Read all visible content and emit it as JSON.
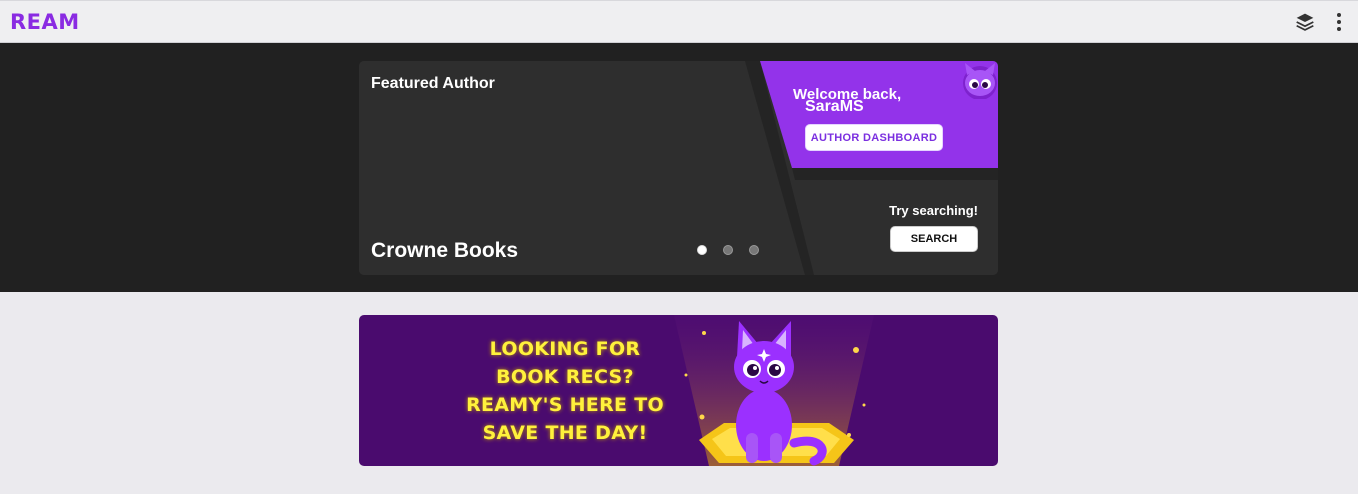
{
  "app": {
    "logo": "REAM"
  },
  "topbar": {
    "icons": [
      "layers-icon",
      "more-vertical-icon"
    ]
  },
  "featured": {
    "title": "Featured Author",
    "author_name": "Crowne Books",
    "slides": 3,
    "active_slide": 1
  },
  "welcome_panel": {
    "greeting": "Welcome back,",
    "username": "SaraMS",
    "button_label": "AUTHOR DASHBOARD",
    "accent": "#9333ea"
  },
  "search_panel": {
    "prompt": "Try searching!",
    "button_label": "SEARCH"
  },
  "banner": {
    "lines": [
      "LOOKING FOR",
      "BOOK RECS?",
      "REAMY'S HERE TO",
      "SAVE THE DAY!"
    ],
    "background": "#4a0b6e",
    "text_color": "#fff13c"
  }
}
